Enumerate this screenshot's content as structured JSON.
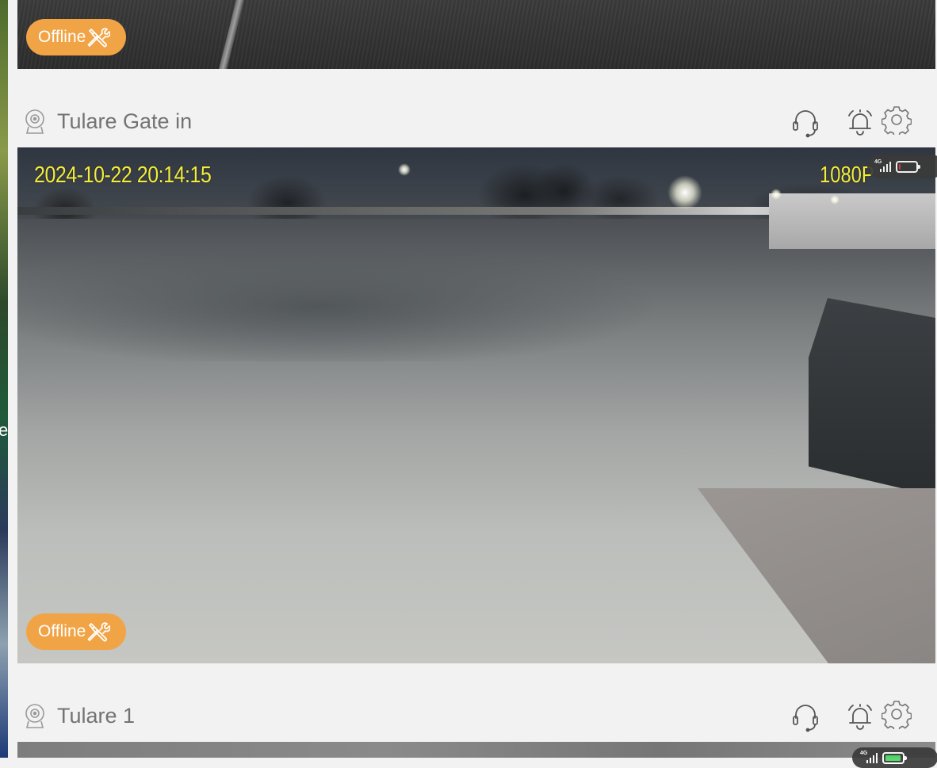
{
  "colors": {
    "accent": "#f0a446",
    "osd_text": "#f3ec3a",
    "title_text": "#737373",
    "background": "#f2f2f2",
    "battery_low": "#e53935",
    "battery_ok": "#4cd964"
  },
  "cameras": [
    {
      "name": "",
      "status_badge": "Offline",
      "status_icon": "tools-icon"
    },
    {
      "name": "Tulare Gate in",
      "osd_timestamp": "2024-10-22  20:14:15",
      "osd_resolution": "1080P",
      "network": "4G",
      "battery_level": 0.1,
      "status_badge": "Offline",
      "status_icon": "tools-icon",
      "actions": [
        "headset-icon",
        "bell-icon",
        "gear-icon"
      ]
    },
    {
      "name": "Tulare 1",
      "network": "4G",
      "battery_level": 0.95,
      "actions": [
        "headset-icon",
        "bell-icon",
        "gear-icon"
      ]
    }
  ]
}
